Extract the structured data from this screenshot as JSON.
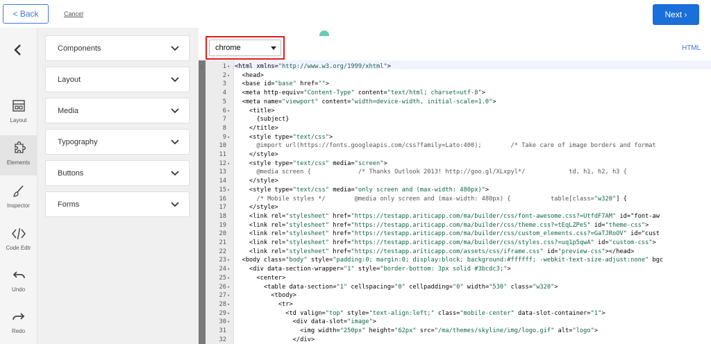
{
  "topbar": {
    "back_label": "< Back",
    "cancel_label": "Cancel",
    "next_label": "Next ›"
  },
  "rail": {
    "items": [
      {
        "label": "Layout",
        "icon": "layout-icon"
      },
      {
        "label": "Elements",
        "icon": "puzzle-icon"
      },
      {
        "label": "Inspector",
        "icon": "brush-icon"
      },
      {
        "label": "Code Edtr",
        "icon": "code-icon"
      },
      {
        "label": "Undo",
        "icon": "undo-icon"
      },
      {
        "label": "Redo",
        "icon": "redo-icon"
      }
    ]
  },
  "panel": {
    "sections": [
      "Components",
      "Layout",
      "Media",
      "Typography",
      "Buttons",
      "Forms"
    ]
  },
  "editor": {
    "browser_select": "chrome",
    "mode_label": "HTML",
    "gutter_marker": "i"
  },
  "code_lines": [
    {
      "n": "1",
      "f": "▾",
      "t": "<html xmlns=\"http://www.w3.org/1999/xhtml\">"
    },
    {
      "n": "2",
      "f": "▾",
      "t": "  <head>"
    },
    {
      "n": "3",
      "f": "",
      "t": "  <base id=\"base\" href=\"\">"
    },
    {
      "n": "4",
      "f": "",
      "t": "  <meta http-equiv=\"Content-Type\" content=\"text/html; charset=utf-8\">"
    },
    {
      "n": "5",
      "f": "",
      "t": "  <meta name=\"viewport\" content=\"width=device-width, initial-scale=1.0\">"
    },
    {
      "n": "6",
      "f": "▾",
      "t": "    <title>"
    },
    {
      "n": "7",
      "f": "",
      "t": "      {subject}"
    },
    {
      "n": "8",
      "f": "",
      "t": "    </title>"
    },
    {
      "n": "9",
      "f": "▾",
      "t": "    <style type=\"text/css\">"
    },
    {
      "n": "10",
      "f": "",
      "t": "      @import url(https://fonts.googleapis.com/css?family=Lato:400);        /* Take care of image borders and format"
    },
    {
      "n": "11",
      "f": "",
      "t": "    </style>"
    },
    {
      "n": "12",
      "f": "▾",
      "t": "    <style type=\"text/css\" media=\"screen\">"
    },
    {
      "n": "13",
      "f": "",
      "t": "      @media screen {             /* Thanks Outlook 2013! http://goo.gl/XLxpyl*/            td, h1, h2, h3 {"
    },
    {
      "n": "14",
      "f": "",
      "t": "    </style>"
    },
    {
      "n": "15",
      "f": "▾",
      "t": "    <style type=\"text/css\" media=\"only screen and (max-width: 480px)\">"
    },
    {
      "n": "16",
      "f": "",
      "t": "      /* Mobile styles */        @media only screen and (max-width: 480px) {           table[class=\"w320\"] {"
    },
    {
      "n": "17",
      "f": "",
      "t": "    </style>"
    },
    {
      "n": "18",
      "f": "",
      "t": "    <link rel=\"stylesheet\" href=\"https://testapp.ariticapp.com/ma/builder/css/font-awesome.css?=UtfdF7AM\" id=\"font-aw"
    },
    {
      "n": "19",
      "f": "",
      "t": "    <link rel=\"stylesheet\" href=\"https://testapp.ariticapp.com/ma/builder/css/theme.css?=tEqLZPeS\" id=\"theme-css\">"
    },
    {
      "n": "20",
      "f": "",
      "t": "    <link rel=\"stylesheet\" href=\"https://testapp.ariticapp.com/ma/builder/css/custom_elements.css?=GaTJRoOV\" id=\"cust"
    },
    {
      "n": "21",
      "f": "",
      "t": "    <link rel=\"stylesheet\" href=\"https://testapp.ariticapp.com/ma/builder/css/styles.css?=uq1p5qwA\" id=\"custom-css\">"
    },
    {
      "n": "22",
      "f": "",
      "t": "    <link rel=\"stylesheet\" href=\"https://testapp.ariticapp.com/assets/css/iframe.css\" id=\"preview-css\"></head>"
    },
    {
      "n": "23",
      "f": "▾",
      "t": "  <body class=\"body\" style=\"padding:0; margin:0; display:block; background:#ffffff; -webkit-text-size-adjust:none\" bgc"
    },
    {
      "n": "24",
      "f": "▾",
      "t": "    <div data-section-wrapper=\"1\" style=\"border-bottom: 3px solid #3bcdc3;\">"
    },
    {
      "n": "25",
      "f": "▾",
      "t": "      <center>"
    },
    {
      "n": "26",
      "f": "▾",
      "t": "        <table data-section=\"1\" cellspacing=\"0\" cellpadding=\"0\" width=\"530\" class=\"w320\">"
    },
    {
      "n": "27",
      "f": "▾",
      "t": "          <tbody>"
    },
    {
      "n": "28",
      "f": "▾",
      "t": "            <tr>"
    },
    {
      "n": "29",
      "f": "▾",
      "t": "              <td valign=\"top\" style=\"text-align:left;\" class=\"mobile-center\" data-slot-container=\"1\">"
    },
    {
      "n": "30",
      "f": "▾",
      "t": "                <div data-slot=\"image\">"
    },
    {
      "n": "31",
      "f": "",
      "t": "                  <img width=\"250px\" height=\"62px\" src=\"/ma/themes/skyline/img/logo.gif\" alt=\"logo\">"
    },
    {
      "n": "32",
      "f": "",
      "t": "                </div>"
    }
  ]
}
